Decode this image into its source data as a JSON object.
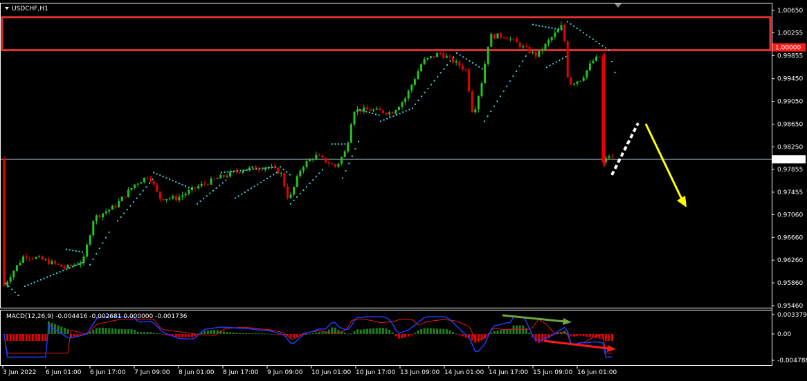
{
  "window": {
    "symbol_title": "USDCHF,H1",
    "menu_arrow": "triangle-down"
  },
  "main": {
    "price_levels": [
      "1.00650",
      "1.00255",
      "0.99855",
      "0.99450",
      "0.99050",
      "0.98650",
      "0.98250",
      "0.97855",
      "0.97455",
      "0.97060",
      "0.96660",
      "0.96260",
      "0.95860",
      "0.95460"
    ],
    "current_price": "0.98033",
    "resistance_price": "1.00000",
    "resistance_zone": [
      0.9995,
      1.0053
    ],
    "bars_per_slot": 1,
    "colors": {
      "bull": "#22c322",
      "bear": "#e60000",
      "psar": "#3dd6e0",
      "zone": "#e03030",
      "projection_arrow": "#ffff00",
      "dashed_path": "#ffffff",
      "grid": "#ffffff"
    }
  },
  "macd": {
    "label": "MACD(12,26,9) -0.004416 -0.002681 0.000000 -0.001736",
    "levels": [
      "0.003379",
      "0.00",
      "-0.004788"
    ],
    "colors": {
      "macd_line": "#1f3cff",
      "signal_line": "#e81a1a",
      "hist_pos": "#1e7d1e",
      "hist_neg": "#e60000",
      "green_arrow": "#6fa63a",
      "red_arrow": "#ff1a1a"
    }
  },
  "time_axis": {
    "labels": [
      "3 Jun 2022",
      "6 Jun 01:00",
      "6 Jun 17:00",
      "7 Jun 09:00",
      "8 Jun 01:00",
      "8 Jun 17:00",
      "9 Jun 09:00",
      "10 Jun 01:00",
      "10 Jun 17:00",
      "13 Jun 09:00",
      "14 Jun 01:00",
      "14 Jun 17:00",
      "15 Jun 09:00",
      "16 Jun 01:00"
    ]
  }
}
